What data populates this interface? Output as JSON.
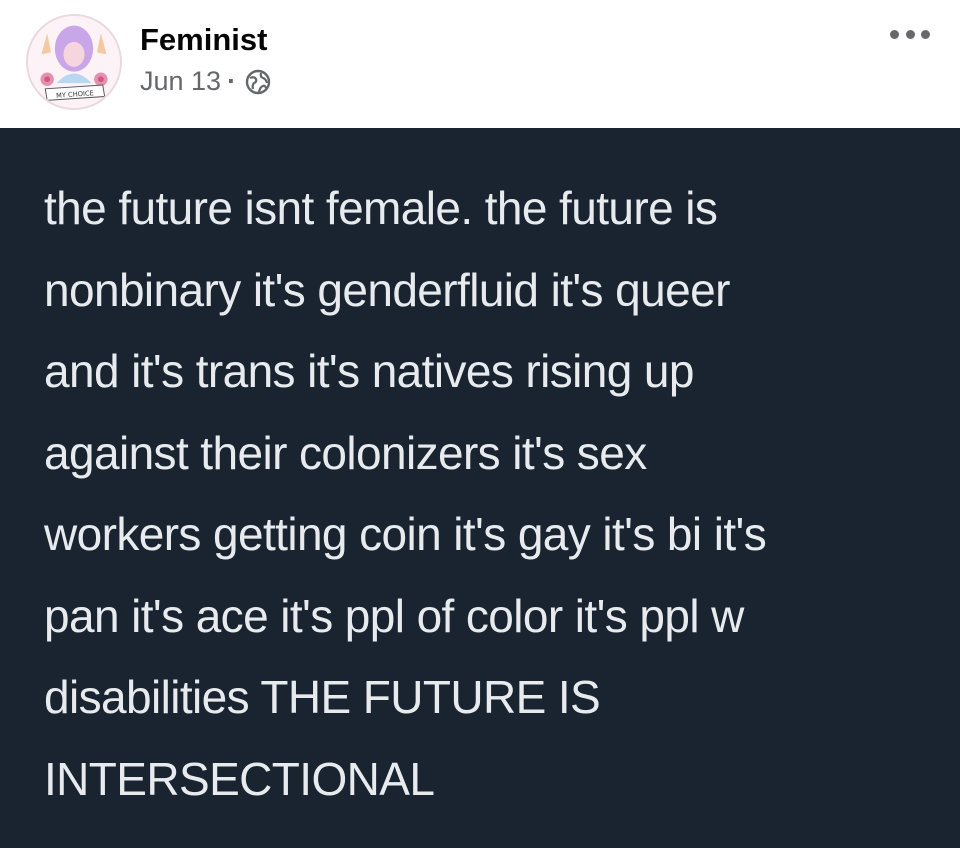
{
  "post": {
    "author": "Feminist",
    "date": "Jun 13",
    "separator": "·",
    "privacy_icon": "globe-icon",
    "more_icon": "more-options-icon",
    "avatar": {
      "badge_text": "MY CHOICE",
      "colors": {
        "hair": "#c9a6e8",
        "flowers": "#e88fb0",
        "banner": "#ffffff"
      }
    }
  },
  "image": {
    "background": "#1a2431",
    "text_color": "#e8ebee",
    "text": "the future isnt female. the future is\nnonbinary it's genderfluid it's queer\nand it's trans it's natives rising up\nagainst their colonizers it's sex\nworkers getting coin it's gay it's bi it's\npan it's ace it's ppl of color it's ppl w\ndisabilities THE FUTURE IS\nINTERSECTIONAL"
  }
}
